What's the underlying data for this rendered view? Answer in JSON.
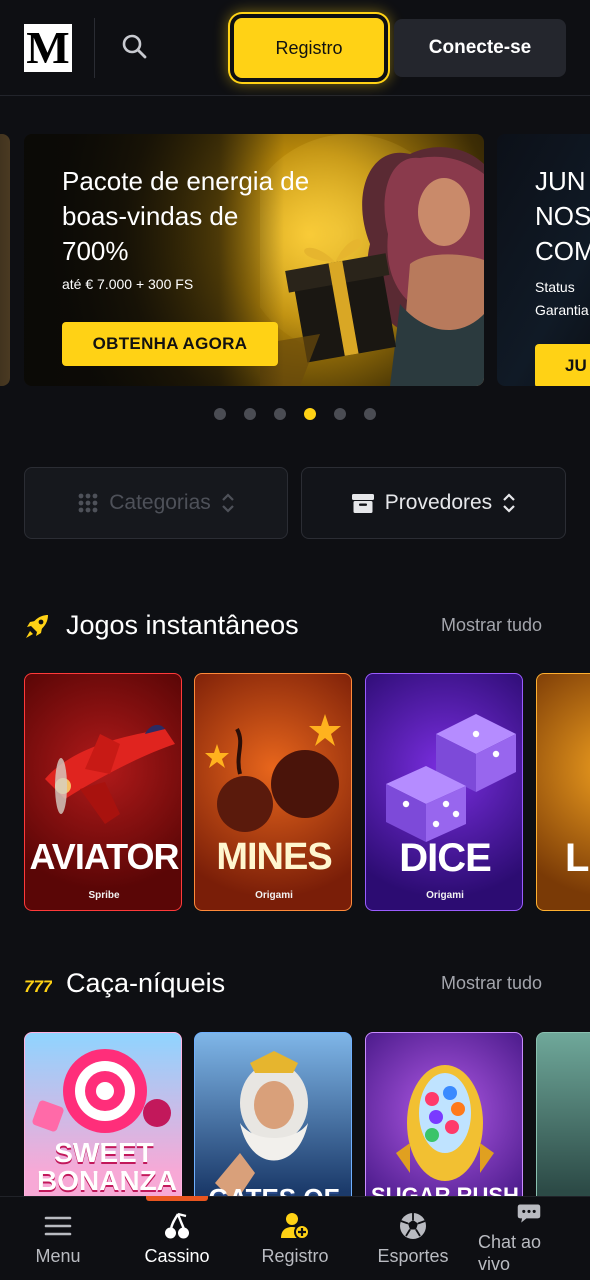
{
  "header": {
    "logo_letter": "M",
    "register_label": "Registro",
    "login_label": "Conecte-se"
  },
  "banner": {
    "title": "Pacote de energia de boas-vindas de 700%",
    "subtitle": "até € 7.000 + 300 FS",
    "cta": "OBTENHA AGORA",
    "next_title": "JUN\nNOS\nCOM",
    "next_sub": "Status\nGarantia",
    "next_cta": "JU",
    "dots_count": 6,
    "active_dot": 4
  },
  "filters": {
    "categories_label": "Categorias",
    "providers_label": "Provedores"
  },
  "sections": {
    "instant": {
      "title": "Jogos instantâneos",
      "more": "Mostrar tudo",
      "games": [
        {
          "name": "AVIATOR",
          "provider": "Spribe"
        },
        {
          "name": "MINES",
          "provider": "Origami"
        },
        {
          "name": "DICE",
          "provider": "Origami"
        },
        {
          "name": "L",
          "provider": ""
        }
      ]
    },
    "slots": {
      "title": "Caça-níqueis",
      "more": "Mostrar tudo",
      "games": [
        {
          "name": "SWEET BONANZA"
        },
        {
          "name": "GATES OF"
        },
        {
          "name": "SUGAR RUSH"
        },
        {
          "name": ""
        }
      ]
    }
  },
  "bottom_nav": {
    "items": [
      {
        "label": "Menu",
        "icon": "hamburger-icon"
      },
      {
        "label": "Cassino",
        "icon": "cherries-icon"
      },
      {
        "label": "Registro",
        "icon": "add-user-icon"
      },
      {
        "label": "Esportes",
        "icon": "soccer-ball-icon"
      },
      {
        "label": "Chat ao vivo",
        "icon": "chat-support-icon"
      }
    ],
    "active": "Cassino"
  },
  "colors": {
    "accent": "#ffd215",
    "background": "#0e0f13",
    "active_indicator": "#e8551f"
  }
}
